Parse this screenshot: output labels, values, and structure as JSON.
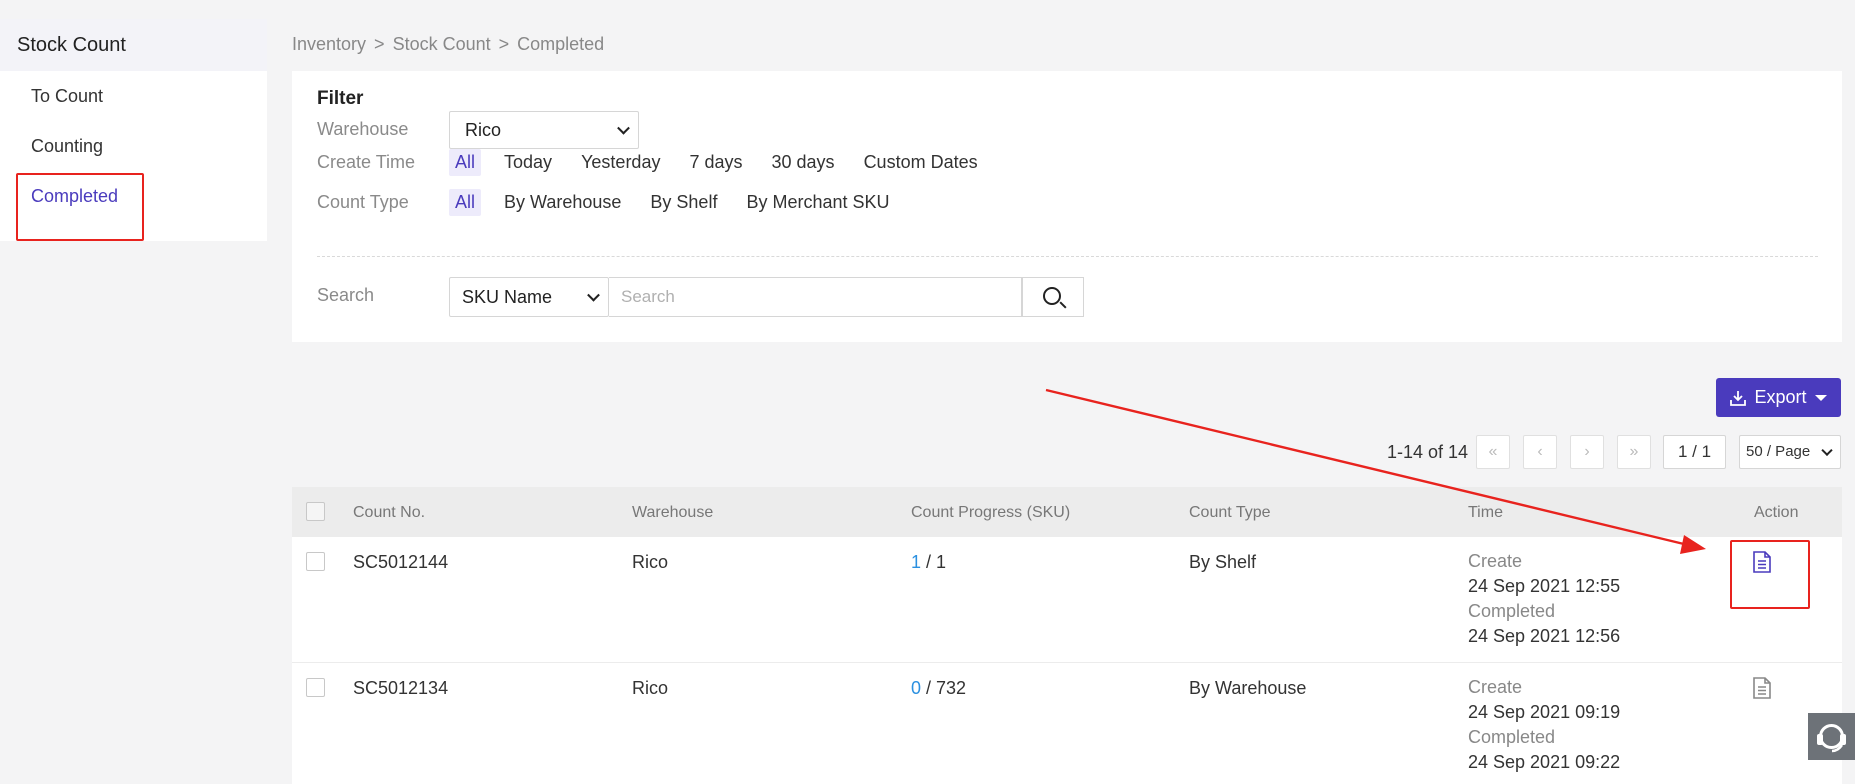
{
  "sidebar": {
    "title": "Stock Count",
    "items": [
      {
        "label": "To Count"
      },
      {
        "label": "Counting"
      },
      {
        "label": "Completed"
      }
    ]
  },
  "breadcrumb": [
    "Inventory",
    "Stock Count",
    "Completed"
  ],
  "filter": {
    "title": "Filter",
    "warehouse_label": "Warehouse",
    "warehouse_value": "Rico",
    "create_time_label": "Create Time",
    "create_time_options": [
      "All",
      "Today",
      "Yesterday",
      "7 days",
      "30 days",
      "Custom Dates"
    ],
    "count_type_label": "Count Type",
    "count_type_options": [
      "All",
      "By Warehouse",
      "By Shelf",
      "By Merchant SKU"
    ],
    "search_label": "Search",
    "search_field": "SKU Name",
    "search_placeholder": "Search"
  },
  "toolbar": {
    "export_label": "Export"
  },
  "pagination": {
    "summary": "1-14 of 14",
    "page_indicator": "1 / 1",
    "page_size": "50 / Page"
  },
  "table": {
    "headers": [
      "Count No.",
      "Warehouse",
      "Count Progress (SKU)",
      "Count Type",
      "Time",
      "Action"
    ],
    "rows": [
      {
        "count_no": "SC5012144",
        "warehouse": "Rico",
        "progress_done": "1",
        "progress_total": "/ 1",
        "count_type": "By Shelf",
        "create_label": "Create",
        "create_time": "24 Sep 2021 12:55",
        "completed_label": "Completed",
        "completed_time": "24 Sep 2021 12:56"
      },
      {
        "count_no": "SC5012134",
        "warehouse": "Rico",
        "progress_done": "0",
        "progress_total": "/ 732",
        "count_type": "By Warehouse",
        "create_label": "Create",
        "create_time": "24 Sep 2021 09:19",
        "completed_label": "Completed",
        "completed_time": "24 Sep 2021 09:22"
      }
    ]
  },
  "colors": {
    "accent": "#4a3bbd",
    "progress_link": "#2b90e0",
    "annotation": "#e8231e"
  },
  "icons": {
    "view_detail": "document-icon",
    "export": "download-icon",
    "support": "headset-icon"
  }
}
